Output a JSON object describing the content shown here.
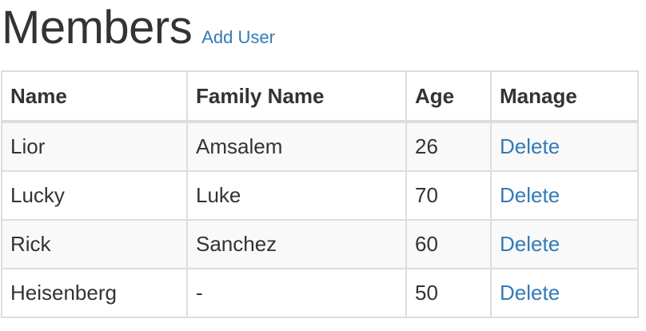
{
  "header": {
    "title": "Members",
    "add_user_label": "Add User"
  },
  "table": {
    "columns": [
      "Name",
      "Family Name",
      "Age",
      "Manage"
    ],
    "rows": [
      {
        "name": "Lior",
        "family_name": "Amsalem",
        "age": "26",
        "action": "Delete"
      },
      {
        "name": "Lucky",
        "family_name": "Luke",
        "age": "70",
        "action": "Delete"
      },
      {
        "name": "Rick",
        "family_name": "Sanchez",
        "age": "60",
        "action": "Delete"
      },
      {
        "name": "Heisenberg",
        "family_name": "-",
        "age": "50",
        "action": "Delete"
      }
    ]
  },
  "colors": {
    "link": "#337ab7",
    "text": "#333333",
    "border": "#dddddd",
    "stripe": "#f9f9f9"
  }
}
